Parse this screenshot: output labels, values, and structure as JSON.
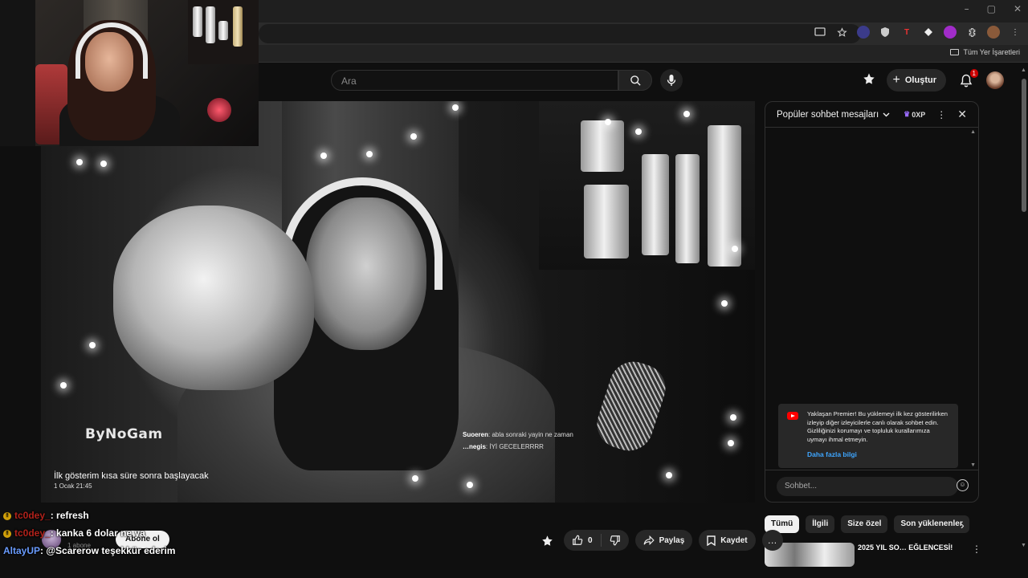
{
  "browser": {
    "win_min": "–",
    "win_max": "▢",
    "win_close": "✕",
    "bookmarks_label": "Tüm Yer İşaretleri"
  },
  "header": {
    "search_placeholder": "Ara",
    "create_label": "Oluştur",
    "notif_count": "1"
  },
  "player": {
    "watermark": "ByNoGam",
    "overlay_chat": [
      {
        "user": "Suoeren",
        "text": ": abla sonraki yayin ne zaman"
      },
      {
        "user": "…negis",
        "text": ": İYİ GECELERRRR"
      }
    ],
    "premiere_message": "İlk gösterim kısa süre sonra başlayacak",
    "premiere_time": "1 Ocak 21:45"
  },
  "chat": {
    "title": "Popüler sohbet mesajları",
    "xp_label": "0XP",
    "notice_text": "Yaklaşan Premier! Bu yüklemeyi ilk kez gösterilirken izleyip diğer izleyicilerle canlı olarak sohbet edin. Gizliliğinizi korumayı ve topluluk kurallarımıza uymayı ihmal etmeyin.",
    "notice_link": "Daha fazla bilgi",
    "input_placeholder": "Sohbet..."
  },
  "chips": [
    "Tümü",
    "İlgili",
    "Size özel",
    "Son yüklenenler"
  ],
  "recommendation": {
    "title": "2025 YIL SO… EĞLENCESİ!"
  },
  "actions": {
    "like_count": "0",
    "share_label": "Paylaş",
    "save_label": "Kaydet",
    "more_label": "…"
  },
  "channel": {
    "subs": "1 abone",
    "subscribe_label": "Abone ol"
  },
  "stream_overlay": [
    {
      "user": "tc0dey_",
      "text": ": refresh"
    },
    {
      "user": "tc0dey_",
      "text": ": kanka 6 dolar ne ya"
    },
    {
      "user": "AltayUP",
      "text": ": @Scarerow teşekkür ederim"
    }
  ],
  "colors": {
    "accent_red": "#ff0000",
    "link_blue": "#3ea6ff",
    "user_red": "#b2221b",
    "user_blue": "#6a9cff"
  }
}
